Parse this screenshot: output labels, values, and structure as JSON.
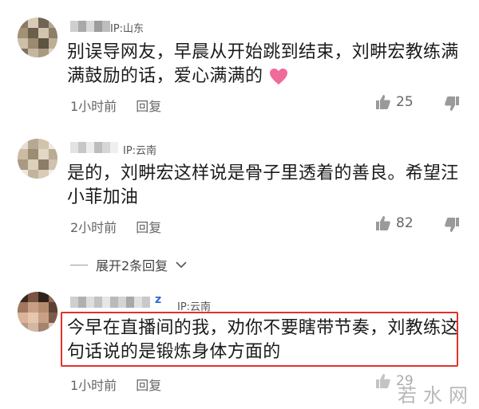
{
  "comments": [
    {
      "ip": "IP:山东",
      "text": "别误导网友，早晨从开始跳到结束，刘畊宏教练满满鼓励的话，爱心满满的",
      "time": "1小时前",
      "reply_label": "回复",
      "likes": "25"
    },
    {
      "ip": "IP:云南",
      "text": "是的，刘畊宏这样说是骨子里透着的善良。希望汪小菲加油",
      "time": "2小时前",
      "reply_label": "回复",
      "likes": "82"
    },
    {
      "ip": "IP:云南",
      "text": "今早在直播间的我，劝你不要瞎带节奏，刘教练这句话说的是锻炼身体方面的",
      "time": "1小时前",
      "reply_label": "回复",
      "likes": "29"
    }
  ],
  "expand_replies": "展开2条回复",
  "watermark": "若水网",
  "colors": {
    "highlight": "#e0322b",
    "heart": "#f06a9a"
  },
  "icons": [
    "thumbs-up-icon",
    "thumbs-down-icon",
    "heart-icon",
    "chevron-down-icon"
  ]
}
